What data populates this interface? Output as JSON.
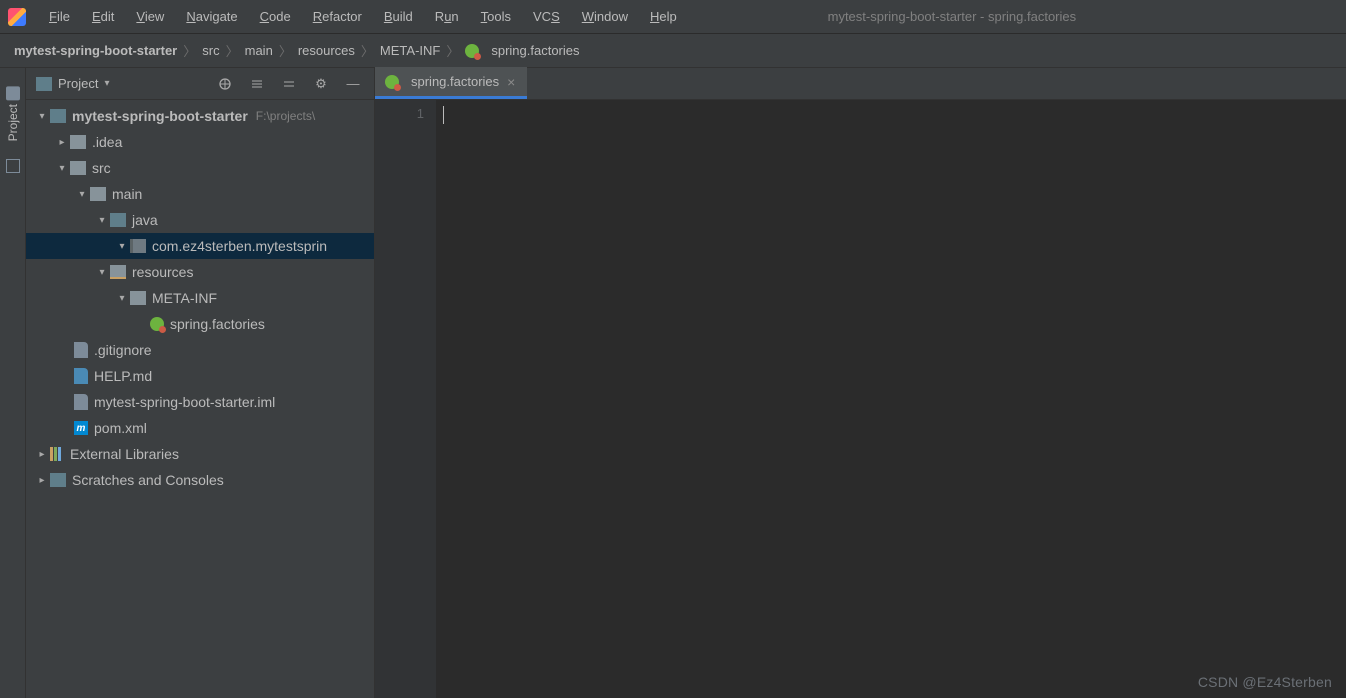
{
  "window": {
    "title": "mytest-spring-boot-starter - spring.factories"
  },
  "menu": [
    "File",
    "Edit",
    "View",
    "Navigate",
    "Code",
    "Refactor",
    "Build",
    "Run",
    "Tools",
    "VCS",
    "Window",
    "Help"
  ],
  "breadcrumb": {
    "root": "mytest-spring-boot-starter",
    "parts": [
      "src",
      "main",
      "resources",
      "META-INF"
    ],
    "leaf": "spring.factories"
  },
  "left_tool": {
    "label": "Project"
  },
  "panel": {
    "title": "Project",
    "tree": {
      "root": {
        "name": "mytest-spring-boot-starter",
        "path": "F:\\projects\\"
      },
      "idea": ".idea",
      "src": "src",
      "main": "main",
      "java": "java",
      "pkg": "com.ez4sterben.mytestsprin",
      "resources": "resources",
      "metainf": "META-INF",
      "factories": "spring.factories",
      "gitignore": ".gitignore",
      "helpmd": "HELP.md",
      "iml": "mytest-spring-boot-starter.iml",
      "pom": "pom.xml",
      "extlib": "External Libraries",
      "scratches": "Scratches and Consoles"
    }
  },
  "tabs": [
    {
      "label": "spring.factories"
    }
  ],
  "gutter": {
    "lines": [
      "1"
    ]
  },
  "watermark": "CSDN @Ez4Sterben"
}
